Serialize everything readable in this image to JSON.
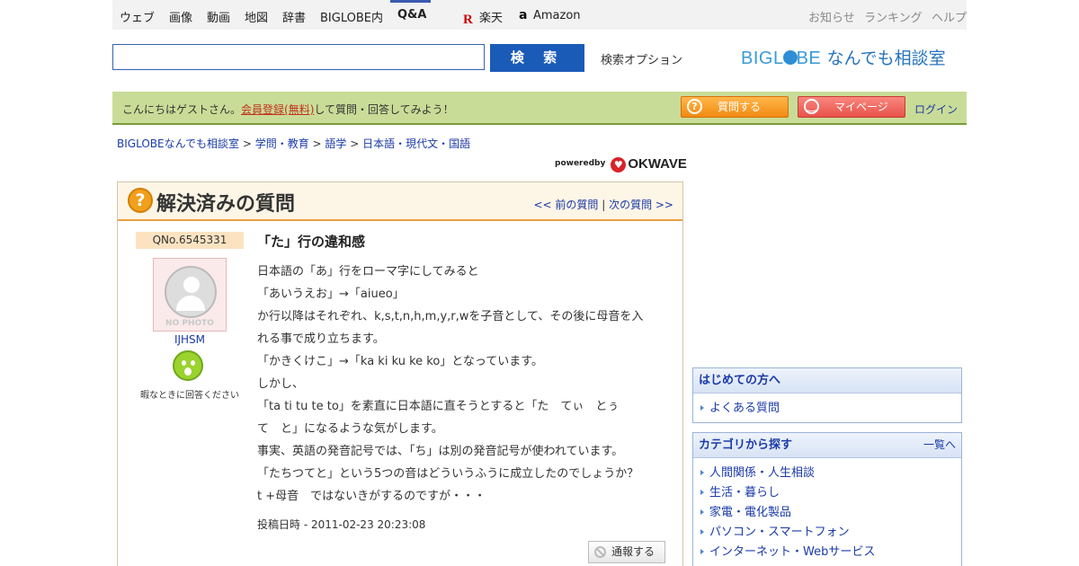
{
  "topnav": {
    "items": [
      "ウェブ",
      "画像",
      "動画",
      "地図",
      "辞書",
      "BIGLOBE内",
      "Q&A"
    ],
    "rakuten": "楽天",
    "amazon": "Amazon",
    "right_links": [
      "お知らせ",
      "ランキング",
      "ヘルプ"
    ]
  },
  "search": {
    "value": "",
    "button_label": "検 索",
    "options_label": "検索オプション"
  },
  "logo": {
    "brand_pre": "BIGL",
    "brand_post": "BE",
    "sub": "なんでも相談室"
  },
  "greeting": {
    "text_before": "こんにちはゲストさん。",
    "register_link": "会員登録(無料)",
    "text_after": "して質問・回答してみよう！",
    "ask_label": "質問する",
    "mypage_label": "マイページ",
    "login_label": "ログイン"
  },
  "breadcrumb": [
    "BIGLOBEなんでも相談室",
    "学問・教育",
    "語学",
    "日本語・現代文・国語"
  ],
  "powered": {
    "prefix": "poweredby",
    "brand": "OKWAVE"
  },
  "question": {
    "header_title": "解決済みの質問",
    "prev_label": "<< 前の質問",
    "next_label": "次の質問 >>",
    "qno": "QNo.6545331",
    "avatar_text": "NO PHOTO",
    "username": "IJHSM",
    "status_text": "暇なときに回答ください",
    "title": "「た」行の違和感",
    "body_lines": [
      "日本語の「あ」行をローマ字にしてみると",
      "「あいうえお」→「aiueo」",
      "か行以降はそれぞれ、k,s,t,n,h,m,y,r,wを子音として、その後に母音を入",
      "れる事で成り立ちます。",
      "「かきくけこ」→「ka ki ku ke ko」となっています。",
      "しかし、",
      "「ta ti tu te to」を素直に日本語に直そうとすると「た　てぃ　とぅ",
      "て　と」になるような気がします。",
      "事実、英語の発音記号では、「ち」は別の発音記号が使われています。",
      "「たちつてと」という5つの音はどういうふうに成立したのでしょうか？",
      "t +母音　ではないきがするのですが・・・"
    ],
    "date": "投稿日時 - 2011-02-23 20:23:08",
    "report_label": "通報する"
  },
  "sidebar": {
    "first_title": "はじめての方へ",
    "first_items": [
      "よくある質問"
    ],
    "cat_title": "カテゴリから探す",
    "cat_more": "一覧へ",
    "cat_items": [
      "人間関係・人生相談",
      "生活・暮らし",
      "家電・電化製品",
      "パソコン・スマートフォン",
      "インターネット・Webサービス"
    ]
  },
  "colors": {
    "nav_bg": "#f2f2f2",
    "search_blue": "#1b5bb8",
    "greet_bg": "#c9dc97",
    "ask_orange": "#f28a12",
    "mypage_red": "#e8524a",
    "link_blue": "#1a3aa8",
    "header_accent": "#e9a040"
  }
}
